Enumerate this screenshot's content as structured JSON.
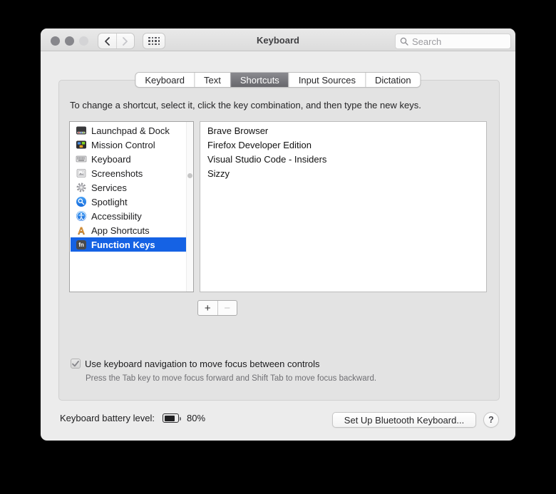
{
  "colors": {
    "selection_blue": "#1562e4",
    "selected_tab_gray": "#77777c",
    "window_bg": "#ececec",
    "list_bg": "#ffffff"
  },
  "titlebar": {
    "title": "Keyboard",
    "search_placeholder": "Search"
  },
  "tabs": {
    "items": [
      {
        "label": "Keyboard",
        "selected": false
      },
      {
        "label": "Text",
        "selected": false
      },
      {
        "label": "Shortcuts",
        "selected": true
      },
      {
        "label": "Input Sources",
        "selected": false
      },
      {
        "label": "Dictation",
        "selected": false
      }
    ]
  },
  "instruction": "To change a shortcut, select it, click the key combination, and then type the new keys.",
  "categories": {
    "items": [
      {
        "label": "Launchpad & Dock",
        "icon": "launchpad-dock-icon",
        "selected": false
      },
      {
        "label": "Mission Control",
        "icon": "mission-control-icon",
        "selected": false
      },
      {
        "label": "Keyboard",
        "icon": "keyboard-icon",
        "selected": false
      },
      {
        "label": "Screenshots",
        "icon": "screenshots-icon",
        "selected": false
      },
      {
        "label": "Services",
        "icon": "services-icon",
        "selected": false
      },
      {
        "label": "Spotlight",
        "icon": "spotlight-icon",
        "selected": false
      },
      {
        "label": "Accessibility",
        "icon": "accessibility-icon",
        "selected": false
      },
      {
        "label": "App Shortcuts",
        "icon": "app-shortcuts-icon",
        "icon_text": "A",
        "selected": false
      },
      {
        "label": "Function Keys",
        "icon": "function-keys-icon",
        "icon_text": "fn",
        "selected": true
      }
    ]
  },
  "app_shortcuts": {
    "items": [
      "Brave Browser",
      "Firefox Developer Edition",
      "Visual Studio Code - Insiders",
      "Sizzy"
    ]
  },
  "list_controls": {
    "add_label": "+",
    "remove_label": "−"
  },
  "keyboard_nav": {
    "checkbox_label": "Use keyboard navigation to move focus between controls",
    "checked": true,
    "help_text": "Press the Tab key to move focus forward and Shift Tab to move focus backward."
  },
  "footer": {
    "battery_label": "Keyboard battery level:",
    "battery_percent": "80%",
    "battery_level": 0.8,
    "setup_button_label": "Set Up Bluetooth Keyboard...",
    "help_button_label": "?"
  }
}
